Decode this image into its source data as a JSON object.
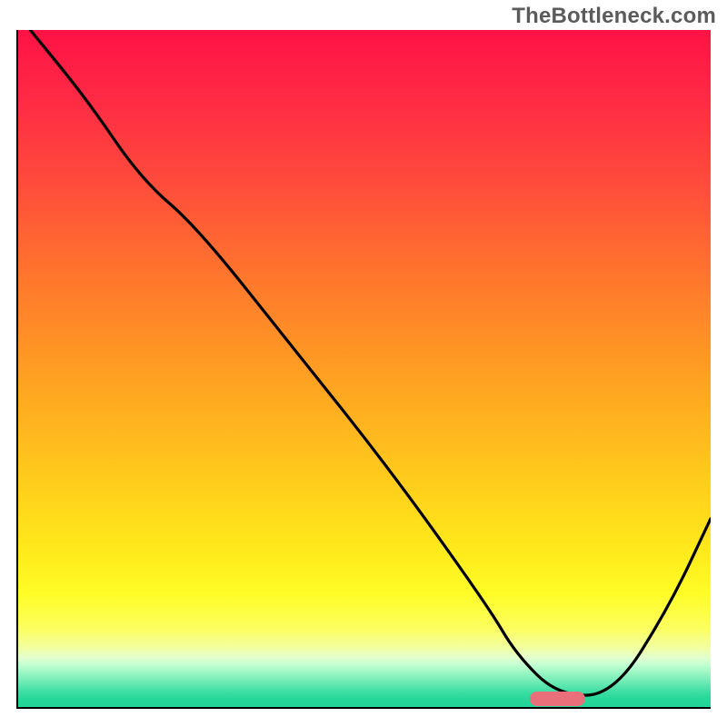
{
  "watermark": "TheBottleneck.com",
  "chart_data": {
    "type": "line",
    "title": "",
    "xlabel": "",
    "ylabel": "",
    "xlim": [
      0,
      100
    ],
    "ylim": [
      0,
      100
    ],
    "note": "Axes are unlabeled; values are estimated from pixel positions on a 0–100 normalized scale for each axis.",
    "series": [
      {
        "name": "bottleneck-curve",
        "x": [
          2,
          10,
          18,
          26,
          40,
          54,
          68,
          72,
          78,
          86,
          94,
          100
        ],
        "y": [
          100,
          90,
          78,
          71,
          53,
          35,
          15,
          8,
          2,
          2,
          15,
          28
        ]
      }
    ],
    "marker": {
      "name": "highlight-pill",
      "x_range": [
        74,
        82
      ],
      "y": 1.5,
      "note": "Small pink/red pill near the curve minimum, sitting just above y=0."
    },
    "background": {
      "type": "vertical-gradient",
      "stops": [
        {
          "pos": 0.0,
          "color": "#ff1245"
        },
        {
          "pos": 0.5,
          "color": "#ffa020"
        },
        {
          "pos": 0.8,
          "color": "#fff020"
        },
        {
          "pos": 0.92,
          "color": "#e8ffb0"
        },
        {
          "pos": 1.0,
          "color": "#1fd497"
        }
      ]
    }
  }
}
